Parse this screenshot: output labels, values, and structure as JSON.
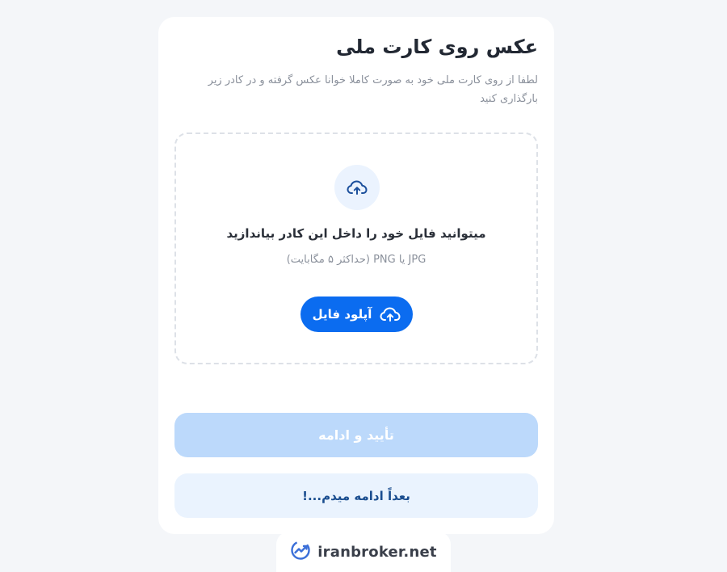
{
  "card": {
    "title": "عکس روی کارت ملی",
    "subtitle": "لطفا از روی کارت ملی خود به صورت کاملا خوانا عکس گرفته و در کادر زیر بارگذاری کنید"
  },
  "dropzone": {
    "icon": "cloud-upload-icon",
    "text": "میتوانید فایل خود را داخل این کادر بیاندازید",
    "hint": "JPG یا PNG (حداکثر ۵ مگابایت)",
    "upload_button_label": "آپلود فایل"
  },
  "actions": {
    "confirm_label": "تأیید و ادامه",
    "later_label": "بعداً ادامه میدم...!"
  },
  "watermark": {
    "text": "iranbroker.net",
    "logo": "iranbroker-logo-icon"
  },
  "colors": {
    "background": "#f4f6f9",
    "card": "#ffffff",
    "primary": "#0b6cf0",
    "primary_disabled": "#bcd9fb",
    "secondary_bg": "#eaf3fe",
    "secondary_text": "#1a4d8f"
  }
}
